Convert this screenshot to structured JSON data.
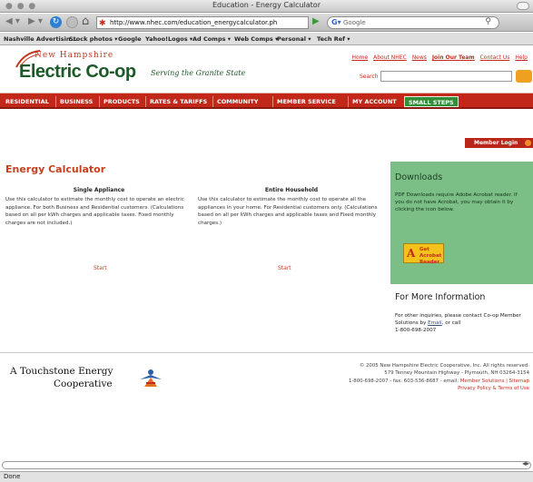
{
  "browser": {
    "window_title": "Education - Energy Calculator",
    "url": "http://www.nhec.com/education_energycalculator.ph",
    "search_engine": "Google",
    "status": "Done",
    "bookmarks": [
      "Nashville Advertisin...",
      "Stock photos ▾",
      "Google",
      "Yahoo!",
      "Logos ▾",
      "Ad Comps ▾",
      "Web Comps ▾",
      "Personal ▾",
      "Tech Ref ▾"
    ]
  },
  "site": {
    "logo_top": "New Hampshire",
    "logo_main": "Electric Co-op",
    "tagline": "Serving the Granite State",
    "top_links": [
      "Home",
      "About NHEC",
      "News",
      "Join Our Team",
      "Contact Us",
      "Help"
    ],
    "search_label": "Search",
    "nav": [
      "RESIDENTIAL",
      "BUSINESS",
      "PRODUCTS",
      "RATES & TARIFFS",
      "COMMUNITY",
      "MEMBER SERVICE",
      "MY ACCOUNT",
      "SMALL STEPS"
    ],
    "member_login": "Member Login"
  },
  "main": {
    "title": "Energy Calculator",
    "single": {
      "heading": "Single Appliance",
      "text": "Use this calculator to estimate the monthly cost to operate an electric appliance. For both Business and Residential customers. (Calculations based on all per kWh charges and applicable taxes. Fixed monthly charges are not included.)",
      "start": "Start"
    },
    "household": {
      "heading": "Entire Household",
      "text": "Use this calculator to estimate the monthly cost to operate all the appliances in your home. For Residential customers only. (Calculations based on all per kWh charges and applicable taxes and Fixed monthly charges.)",
      "start": "Start"
    }
  },
  "sidebar": {
    "downloads_title": "Downloads",
    "downloads_text": "PDF Downloads require Adobe Acrobat reader. If you do not have Acrobat, you may obtain it by clicking the icon below.",
    "acrobat_line1": "Get Acrobat",
    "acrobat_line2": "Reader",
    "more_title": "For More Information",
    "more_text_pre": "For other inquiries, please contact Co-op Member Solutions by",
    "more_link": "Email",
    "more_text_post": ", or call",
    "more_phone": "1-800-698-2007"
  },
  "footer": {
    "touchstone_line1": "A Touchstone Energy",
    "touchstone_line2": "Cooperative",
    "copyright": "© 2005 New Hampshire Electric Cooperative, Inc. All rights reserved.",
    "address": "579 Tenney Mountain Highway - Plymouth, NH 03264-3154",
    "contact": "1-800-698-2007 - fax: 603-536-8687 - email:",
    "contact_link": "Member Solutions | Sitemap",
    "policy": "Privacy Policy & Terms of Use"
  },
  "colors": {
    "nav_red": "#c1281a",
    "brand_green": "#1d5a2a",
    "downloads_green": "#7cbf86",
    "accent_orange": "#c4411e"
  }
}
